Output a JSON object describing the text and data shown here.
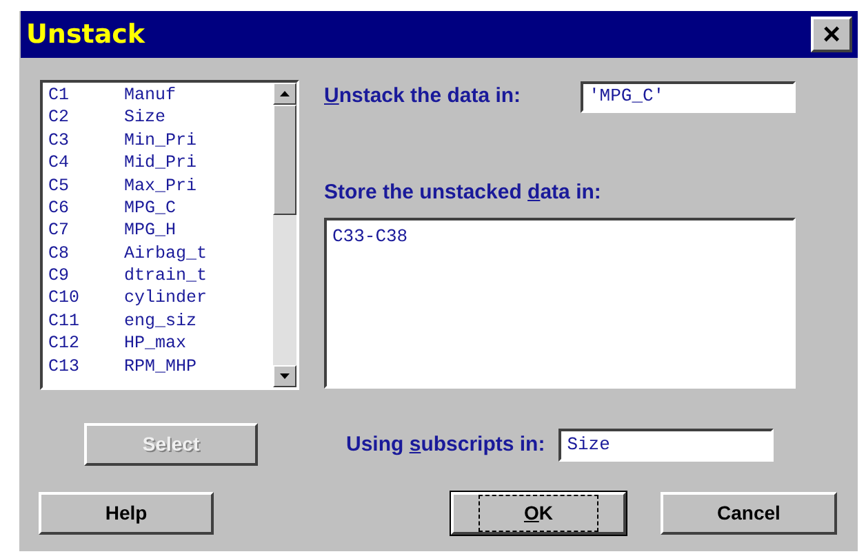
{
  "window": {
    "title": "Unstack",
    "close_label": "×"
  },
  "columns_list": [
    {
      "id": "C1",
      "name": "Manuf"
    },
    {
      "id": "C2",
      "name": "Size"
    },
    {
      "id": "C3",
      "name": "Min_Pri"
    },
    {
      "id": "C4",
      "name": "Mid_Pri"
    },
    {
      "id": "C5",
      "name": "Max_Pri"
    },
    {
      "id": "C6",
      "name": "MPG_C"
    },
    {
      "id": "C7",
      "name": "MPG_H"
    },
    {
      "id": "C8",
      "name": "Airbag_t"
    },
    {
      "id": "C9",
      "name": "dtrain_t"
    },
    {
      "id": "C10",
      "name": "cylinder"
    },
    {
      "id": "C11",
      "name": "eng_siz"
    },
    {
      "id": "C12",
      "name": "HP_max"
    },
    {
      "id": "C13",
      "name": "RPM_MHP"
    }
  ],
  "unstack_field": {
    "label": [
      {
        "text": "U",
        "underlined": true
      },
      {
        "text": "nstack the data in:",
        "underlined": false
      }
    ],
    "value": "'MPG_C'"
  },
  "store_field": {
    "label": [
      {
        "text": "Store the unstacked ",
        "underlined": false
      },
      {
        "text": "d",
        "underlined": true
      },
      {
        "text": "ata in:",
        "underlined": false
      }
    ],
    "value": "C33-C38"
  },
  "subscripts_field": {
    "label": [
      {
        "text": "Using ",
        "underlined": false
      },
      {
        "text": "s",
        "underlined": true
      },
      {
        "text": "ubscripts in:",
        "underlined": false
      }
    ],
    "value": "Size"
  },
  "buttons": [
    {
      "label": [
        {
          "text": "Select",
          "underlined": false
        }
      ],
      "disabled": true,
      "default": false
    },
    {
      "label": [
        {
          "text": "Help",
          "underlined": false
        }
      ],
      "disabled": false,
      "default": false
    },
    {
      "label": [
        {
          "text": "O",
          "underlined": true
        },
        {
          "text": "K",
          "underlined": false
        }
      ],
      "disabled": false,
      "default": true
    },
    {
      "label": [
        {
          "text": "Cancel",
          "underlined": false
        }
      ],
      "disabled": false,
      "default": false
    }
  ]
}
